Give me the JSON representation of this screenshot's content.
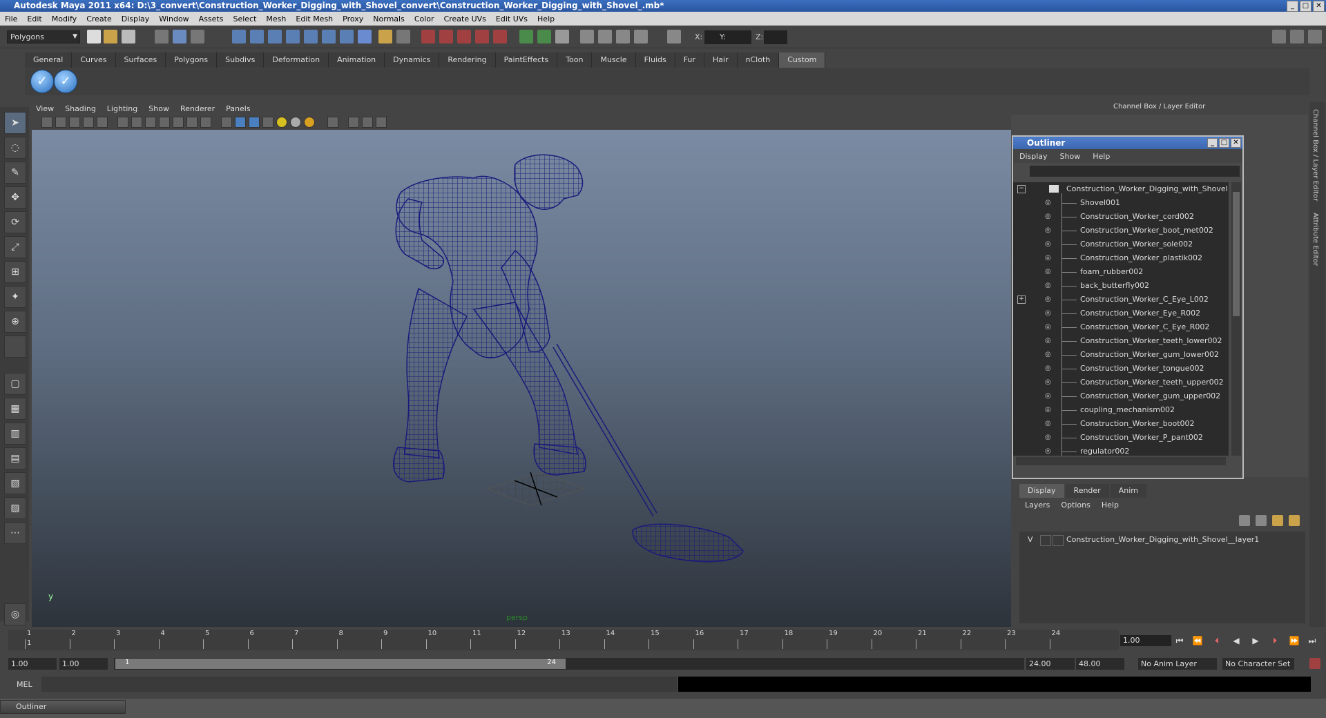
{
  "window": {
    "title": "Autodesk Maya 2011 x64: D:\\3_convert\\Construction_Worker_Digging_with_Shovel_convert\\Construction_Worker_Digging_with_Shovel_.mb*",
    "min": "_",
    "max": "□",
    "close": "✕"
  },
  "menubar": [
    "File",
    "Edit",
    "Modify",
    "Create",
    "Display",
    "Window",
    "Assets",
    "Select",
    "Mesh",
    "Edit Mesh",
    "Proxy",
    "Normals",
    "Color",
    "Create UVs",
    "Edit UVs",
    "Help"
  ],
  "toolbar": {
    "mode": "Polygons",
    "x_label": "X:",
    "y_label": "Y:",
    "z_label": "Z:"
  },
  "shelf_tabs": [
    "General",
    "Curves",
    "Surfaces",
    "Polygons",
    "Subdivs",
    "Deformation",
    "Animation",
    "Dynamics",
    "Rendering",
    "PaintEffects",
    "Toon",
    "Muscle",
    "Fluids",
    "Fur",
    "Hair",
    "nCloth",
    "Custom"
  ],
  "viewport_menu": [
    "View",
    "Shading",
    "Lighting",
    "Show",
    "Renderer",
    "Panels"
  ],
  "viewport": {
    "camera_label": "persp",
    "axis_y": "y",
    "wire_color": "#1a1a7a"
  },
  "channel_box_title": "Channel Box / Layer Editor",
  "side_tabs": [
    "Channel Box / Layer Editor",
    "Attribute Editor"
  ],
  "outliner": {
    "title": "Outliner",
    "menu": [
      "Display",
      "Show",
      "Help"
    ],
    "root": "Construction_Worker_Digging_with_Shovel",
    "items": [
      "Shovel001",
      "Construction_Worker_cord002",
      "Construction_Worker_boot_met002",
      "Construction_Worker_sole002",
      "Construction_Worker_plastik002",
      "foam_rubber002",
      "back_butterfly002",
      "Construction_Worker_C_Eye_L002",
      "Construction_Worker_Eye_R002",
      "Construction_Worker_C_Eye_R002",
      "Construction_Worker_teeth_lower002",
      "Construction_Worker_gum_lower002",
      "Construction_Worker_tongue002",
      "Construction_Worker_teeth_upper002",
      "Construction_Worker_gum_upper002",
      "coupling_mechanism002",
      "Construction_Worker_boot002",
      "Construction_Worker_P_pant002",
      "regulator002"
    ]
  },
  "layer_editor": {
    "tabs": [
      "Display",
      "Render",
      "Anim"
    ],
    "menu": [
      "Layers",
      "Options",
      "Help"
    ],
    "layer_visible": "V",
    "layer_name": "Construction_Worker_Digging_with_Shovel__layer1"
  },
  "timeline": {
    "ticks": [
      "1",
      "2",
      "3",
      "4",
      "5",
      "6",
      "7",
      "8",
      "9",
      "10",
      "11",
      "12",
      "13",
      "14",
      "15",
      "16",
      "17",
      "18",
      "19",
      "20",
      "21",
      "22",
      "23",
      "24"
    ],
    "current_frame_marker": "1",
    "current_frame": "1.00"
  },
  "range": {
    "start": "1.00",
    "playback_start": "1.00",
    "slider_start": "1",
    "slider_end": "24",
    "playback_end": "24.00",
    "end": "48.00",
    "anim_layer": "No Anim Layer",
    "character_set": "No Character Set"
  },
  "command": {
    "label": "MEL"
  },
  "taskbar": {
    "outliner_label": "Outliner"
  }
}
